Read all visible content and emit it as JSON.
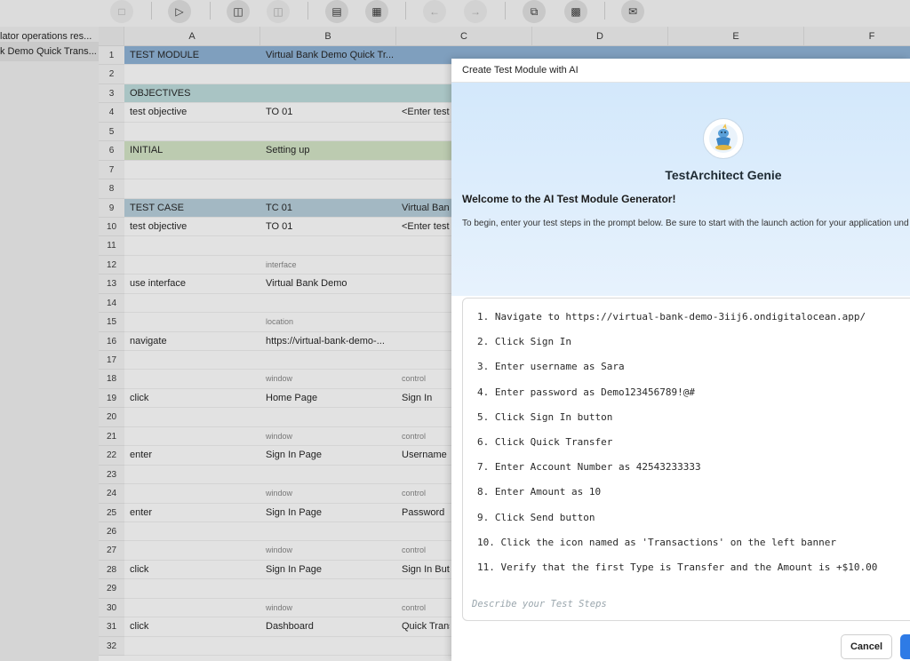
{
  "sidebar": {
    "items": [
      {
        "label": "lator operations res..."
      },
      {
        "label": "k Demo Quick Trans..."
      }
    ]
  },
  "grid": {
    "columns": [
      "A",
      "B",
      "C",
      "D",
      "E",
      "F"
    ],
    "rows": [
      {
        "num": "1",
        "a": "TEST MODULE",
        "b": "Virtual Bank Demo Quick Tr...",
        "c": ""
      },
      {
        "num": "2",
        "a": "",
        "b": "",
        "c": ""
      },
      {
        "num": "3",
        "a": "OBJECTIVES",
        "b": "",
        "c": ""
      },
      {
        "num": "4",
        "a": "test objective",
        "b": "TO 01",
        "c": "<Enter test"
      },
      {
        "num": "5",
        "a": "",
        "b": "",
        "c": ""
      },
      {
        "num": "6",
        "a": "INITIAL",
        "b": "Setting up",
        "c": ""
      },
      {
        "num": "7",
        "a": "",
        "b": "",
        "c": ""
      },
      {
        "num": "8",
        "a": "",
        "b": "",
        "c": ""
      },
      {
        "num": "9",
        "a": "TEST CASE",
        "b": "TC 01",
        "c": "Virtual Bank"
      },
      {
        "num": "10",
        "a": "test objective",
        "b": "TO 01",
        "c": "<Enter test"
      },
      {
        "num": "11",
        "a": "",
        "b": "",
        "c": ""
      },
      {
        "num": "12",
        "a": "",
        "b": "interface",
        "c": ""
      },
      {
        "num": "13",
        "a": "use interface",
        "b": "Virtual Bank Demo",
        "c": ""
      },
      {
        "num": "14",
        "a": "",
        "b": "",
        "c": ""
      },
      {
        "num": "15",
        "a": "",
        "b": "location",
        "c": ""
      },
      {
        "num": "16",
        "a": "navigate",
        "b": "https://virtual-bank-demo-...",
        "c": ""
      },
      {
        "num": "17",
        "a": "",
        "b": "",
        "c": ""
      },
      {
        "num": "18",
        "a": "",
        "b": "window",
        "c": "control"
      },
      {
        "num": "19",
        "a": "click",
        "b": "Home Page",
        "c": "Sign In"
      },
      {
        "num": "20",
        "a": "",
        "b": "",
        "c": ""
      },
      {
        "num": "21",
        "a": "",
        "b": "window",
        "c": "control"
      },
      {
        "num": "22",
        "a": "enter",
        "b": "Sign In Page",
        "c": "Username"
      },
      {
        "num": "23",
        "a": "",
        "b": "",
        "c": ""
      },
      {
        "num": "24",
        "a": "",
        "b": "window",
        "c": "control"
      },
      {
        "num": "25",
        "a": "enter",
        "b": "Sign In Page",
        "c": "Password"
      },
      {
        "num": "26",
        "a": "",
        "b": "",
        "c": ""
      },
      {
        "num": "27",
        "a": "",
        "b": "window",
        "c": "control"
      },
      {
        "num": "28",
        "a": "click",
        "b": "Sign In Page",
        "c": "Sign In Butt"
      },
      {
        "num": "29",
        "a": "",
        "b": "",
        "c": ""
      },
      {
        "num": "30",
        "a": "",
        "b": "window",
        "c": "control"
      },
      {
        "num": "31",
        "a": "click",
        "b": "Dashboard",
        "c": "Quick Trans"
      },
      {
        "num": "32",
        "a": "",
        "b": "",
        "c": ""
      }
    ]
  },
  "modal": {
    "title": "Create Test Module with AI",
    "genie_name": "TestArchitect Genie",
    "welcome": "Welcome to the AI Test Module Generator!",
    "instructions": "To begin, enter your test steps in the prompt below. Be sure to start with the launch action for your application und",
    "steps": [
      "1. Navigate to https://virtual-bank-demo-3iij6.ondigitalocean.app/",
      "2. Click Sign In",
      "3. Enter username as Sara",
      "4. Enter password as Demo123456789!@#",
      "5. Click Sign In button",
      "6. Click Quick Transfer",
      "7. Enter Account Number as 42543233333",
      "8. Enter Amount as 10",
      "9. Click Send button",
      "10. Click the icon named as 'Transactions' on the left banner",
      "11. Verify that the first Type is Transfer and the Amount is +$10.00"
    ],
    "placeholder": "Describe your Test Steps",
    "cancel_label": "Cancel"
  },
  "colors": {
    "accent": "#2e7be6",
    "hero_bg": "#d3e8fb"
  }
}
